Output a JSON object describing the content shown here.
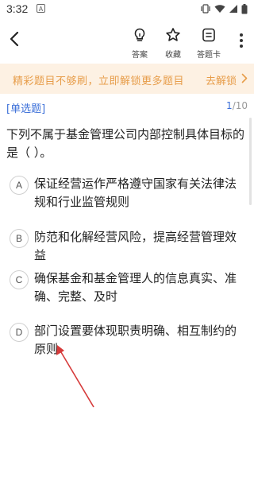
{
  "status": {
    "time": "3:32",
    "notification": "A"
  },
  "toolbar": {
    "answer_label": "答案",
    "favorite_label": "收藏",
    "answer_card_label": "答题卡"
  },
  "banner": {
    "message": "精彩题目不够刷，立即解锁更多题目",
    "action": "去解锁",
    "color": "#e79d4a"
  },
  "question": {
    "type": "[单选题]",
    "current": "1",
    "total": "/10",
    "text": "下列不属于基金管理公司内部控制具体目标的是（ ）。"
  },
  "options": [
    {
      "letter": "A",
      "text": "保证经营运作严格遵守国家有关法律法规和行业监管规则"
    },
    {
      "letter": "B",
      "text": "防范和化解经营风险，提高经营管理效益"
    },
    {
      "letter": "C",
      "text": "确保基金和基金管理人的信息真实、准确、完整、及时"
    },
    {
      "letter": "D",
      "text": "部门设置要体现职责明确、相互制约的原则"
    }
  ],
  "colors": {
    "accent": "#3b6fd8",
    "annotation_arrow": "#d63b3b"
  }
}
